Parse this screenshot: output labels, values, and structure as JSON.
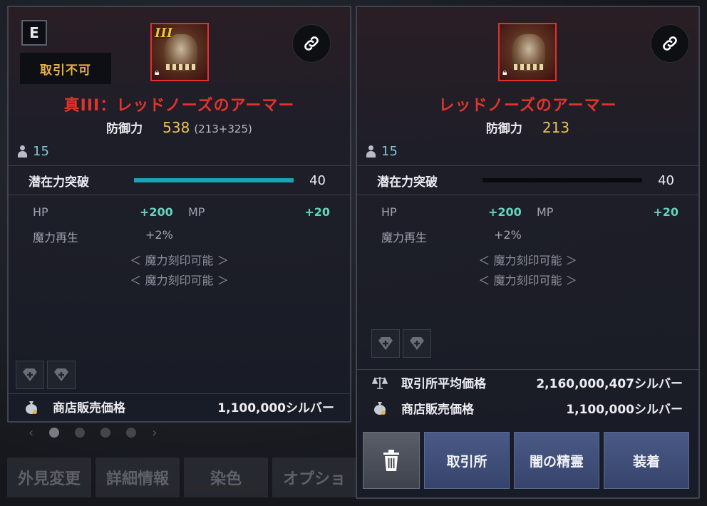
{
  "background": {
    "tabs": [
      "外見変更",
      "詳細情報",
      "染色",
      "オプショ"
    ],
    "pager": {
      "prev": "‹",
      "next": "›",
      "dots": 4,
      "active": 0
    }
  },
  "left_panel": {
    "grade": "E",
    "untradable_label": "取引不可",
    "icon_roman": "III",
    "icon": "armor-icon",
    "item_name": "真III：レッドノーズのアーマー",
    "name_color": "#e2342c",
    "defense_label": "防御力",
    "defense_value": "538",
    "defense_breakdown": "(213+325)",
    "level": "15",
    "potential_label": "潜在力突破",
    "potential_fill": 1.0,
    "potential_value": "40",
    "stats": {
      "hp_label": "HP",
      "hp_value": "+200",
      "mp_label": "MP",
      "mp_value": "+20",
      "regen_label": "魔力再生",
      "regen_value": "+2%"
    },
    "engrave_1": "＜ 魔力刻印可能 ＞",
    "engrave_2": "＜ 魔力刻印可能 ＞",
    "shop_price_label": "商店販売価格",
    "shop_price": "1,100,000シルバー"
  },
  "right_panel": {
    "icon_roman": "",
    "icon": "armor-icon",
    "item_name": "レッドノーズのアーマー",
    "defense_label": "防御力",
    "defense_value": "213",
    "level": "15",
    "potential_label": "潜在力突破",
    "potential_fill": 0.0,
    "potential_value": "40",
    "stats": {
      "hp_label": "HP",
      "hp_value": "+200",
      "mp_label": "MP",
      "mp_value": "+20",
      "regen_label": "魔力再生",
      "regen_value": "+2%"
    },
    "engrave_1": "＜ 魔力刻印可能 ＞",
    "engrave_2": "＜ 魔力刻印可能 ＞",
    "market_avg_label": "取引所平均価格",
    "market_avg_price": "2,160,000,407シルバー",
    "shop_price_label": "商店販売価格",
    "shop_price": "1,100,000シルバー"
  },
  "actions": {
    "trash": "trash-icon",
    "market": "取引所",
    "dark_spirit": "闇の精霊",
    "equip": "装着"
  }
}
